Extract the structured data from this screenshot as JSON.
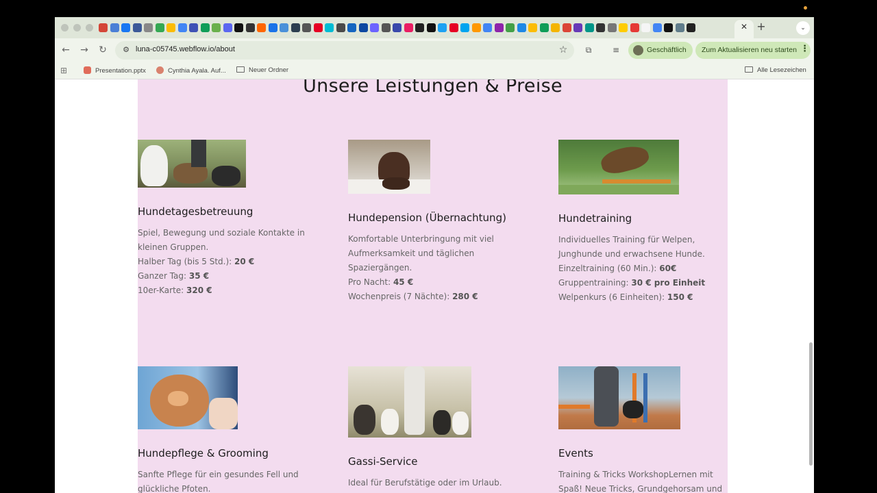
{
  "browser": {
    "url": "luna-c05745.webflow.io/about",
    "profile_label": "Geschäftlich",
    "update_label": "Zum Aktualisieren neu starten",
    "bookmarks": [
      {
        "label": "Presentation.pptx",
        "icon": "powerpoint-icon"
      },
      {
        "label": "Cynthia Ayala. Auf...",
        "icon": "avatar-icon"
      },
      {
        "label": "Neuer Ordner",
        "icon": "folder-icon"
      }
    ],
    "all_bookmarks_label": "Alle Lesezeichen",
    "tab_favicon_colors": [
      "#d44638",
      "#4a7fd6",
      "#1877f2",
      "#3b5998",
      "#888888",
      "#34a853",
      "#fbbc04",
      "#4285f4",
      "#3f51b5",
      "#0f9d58",
      "#6ab04c",
      "#5b67f0",
      "#111111",
      "#333333",
      "#ff6600",
      "#1a73e8",
      "#4a90d9",
      "#2c3e50",
      "#555555",
      "#e60023",
      "#00bcd4",
      "#4a4a4a",
      "#1565c0",
      "#0d47a1",
      "#6c63ff",
      "#555555",
      "#3949ab",
      "#e91e63",
      "#212121",
      "#111111",
      "#1da1f2",
      "#e60023",
      "#00a4ef",
      "#ff9800",
      "#4285f4",
      "#8e24aa",
      "#43a047",
      "#1e88e5",
      "#fbbc04",
      "#0f9d58",
      "#f4b400",
      "#db4437",
      "#673ab7",
      "#009688",
      "#333333",
      "#777777",
      "#ffcc00",
      "#e53935",
      "#f5f5f5",
      "#4285f4",
      "#111111",
      "#607d8b",
      "#222222"
    ]
  },
  "page": {
    "section_title": "Unsere Leistungen & Preise",
    "services": [
      {
        "title": "Hundetagesbetreuung",
        "image": "dogs-group-walk-photo",
        "lines": [
          {
            "text": "Spiel, Bewegung und soziale Kontakte in kleinen Gruppen."
          },
          {
            "text": "Halber Tag (bis 5 Std.): ",
            "price": "20 €"
          },
          {
            "text": "Ganzer Tag: ",
            "price": "35 €"
          },
          {
            "text": "10er-Karte: ",
            "price": "320 €"
          }
        ]
      },
      {
        "title": "Hundepension (Übernachtung)",
        "image": "dog-on-bed-photo",
        "lines": [
          {
            "text": "Komfortable Unterbringung mit viel Aufmerksamkeit und täglichen Spaziergängen."
          },
          {
            "text": "Pro Nacht: ",
            "price": "45 €"
          },
          {
            "text": "Wochenpreis (7 Nächte): ",
            "price": "280 €"
          }
        ]
      },
      {
        "title": "Hundetraining",
        "image": "dog-agility-jump-photo",
        "lines": [
          {
            "text": "Individuelles Training für Welpen, Junghunde und erwachsene Hunde."
          },
          {
            "text": "Einzeltraining (60 Min.): ",
            "price": "60€"
          },
          {
            "text": "Gruppentraining: ",
            "price": "30 € pro Einheit"
          },
          {
            "text": "Welpenkurs (6 Einheiten): ",
            "price": "150 €"
          }
        ]
      },
      {
        "title": "Hundepflege & Grooming",
        "image": "dog-grooming-photo",
        "lines": [
          {
            "text": "Sanfte Pflege für ein gesundes Fell und glückliche Pfoten."
          }
        ]
      },
      {
        "title": "Gassi-Service",
        "image": "dog-walker-photo",
        "lines": [
          {
            "text": "Ideal für Berufstätige oder im Urlaub."
          }
        ]
      },
      {
        "title": "Events",
        "image": "dog-training-event-photo",
        "lines": [
          {
            "text": "Training & Tricks WorkshopLernen mit Spaß! Neue Tricks, Grundgehorsam und"
          }
        ]
      }
    ]
  }
}
